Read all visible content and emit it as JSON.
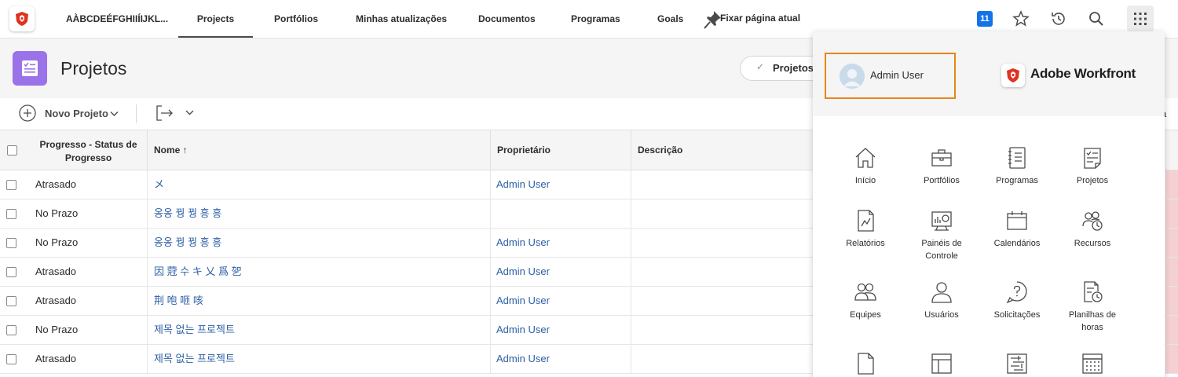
{
  "topbar": {
    "brand_short": "AÀBCDEÉFGHIIÍĲKL...",
    "nav": [
      "Projects",
      "Portfólios",
      "Minhas atualizações",
      "Documentos",
      "Programas",
      "Goals"
    ],
    "active_nav": "Projects",
    "pin_label": "Fixar página atual",
    "notification_count": "11",
    "icons": [
      "star-icon",
      "history-icon",
      "search-icon",
      "apps-grid-icon"
    ]
  },
  "header": {
    "title": "Projetos",
    "view_label": "Projetos"
  },
  "toolbar": {
    "new_project": "Novo Projeto",
    "right_fragment": "a"
  },
  "table": {
    "columns": [
      "Progresso - Status de Progresso",
      "Nome ↑",
      "Proprietário",
      "Descrição"
    ],
    "rows": [
      {
        "status": "Atrasado",
        "name": "メ",
        "owner": "Admin User"
      },
      {
        "status": "No Prazo",
        "name": "옹옹 꿩 꿩 흥 흥",
        "owner": ""
      },
      {
        "status": "No Prazo",
        "name": "옹옹 꿩 꿩 흥 흥",
        "owner": "Admin User"
      },
      {
        "status": "Atrasado",
        "name": "因 蒄 수 キ 乂 爲 乫",
        "owner": "Admin User"
      },
      {
        "status": "Atrasado",
        "name": "荆 咆 咂 咳",
        "owner": "Admin User"
      },
      {
        "status": "No Prazo",
        "name": "제목 없는 프로젝트",
        "owner": "Admin User"
      },
      {
        "status": "Atrasado",
        "name": "제목 없는 프로젝트",
        "owner": "Admin User"
      }
    ]
  },
  "menu": {
    "user_name": "Admin User",
    "brand": "Adobe Workfront",
    "apps": [
      {
        "label": "Início",
        "icon": "home-icon"
      },
      {
        "label": "Portfólios",
        "icon": "briefcase-icon"
      },
      {
        "label": "Programas",
        "icon": "notebook-icon"
      },
      {
        "label": "Projetos",
        "icon": "checklist-icon"
      },
      {
        "label": "Relatórios",
        "icon": "report-icon"
      },
      {
        "label": "Painéis de Controle",
        "icon": "dashboard-icon"
      },
      {
        "label": "Calendários",
        "icon": "calendar-icon"
      },
      {
        "label": "Recursos",
        "icon": "resources-icon"
      },
      {
        "label": "Equipes",
        "icon": "teams-icon"
      },
      {
        "label": "Usuários",
        "icon": "user-icon"
      },
      {
        "label": "Solicitações",
        "icon": "request-icon"
      },
      {
        "label": "Planilhas de horas",
        "icon": "timesheet-icon"
      },
      {
        "label": "",
        "icon": "document-icon"
      },
      {
        "label": "",
        "icon": "layout-template-icon"
      },
      {
        "label": "",
        "icon": "scenario-icon"
      },
      {
        "label": "",
        "icon": "table-icon"
      }
    ]
  },
  "colors": {
    "accent_blue": "#1473e6",
    "link_blue": "#2d5fa6",
    "project_purple": "#9b73e8",
    "highlight_orange": "#e68619",
    "brand_red": "#e0321f",
    "overdue_pink": "#f5d0d3"
  }
}
